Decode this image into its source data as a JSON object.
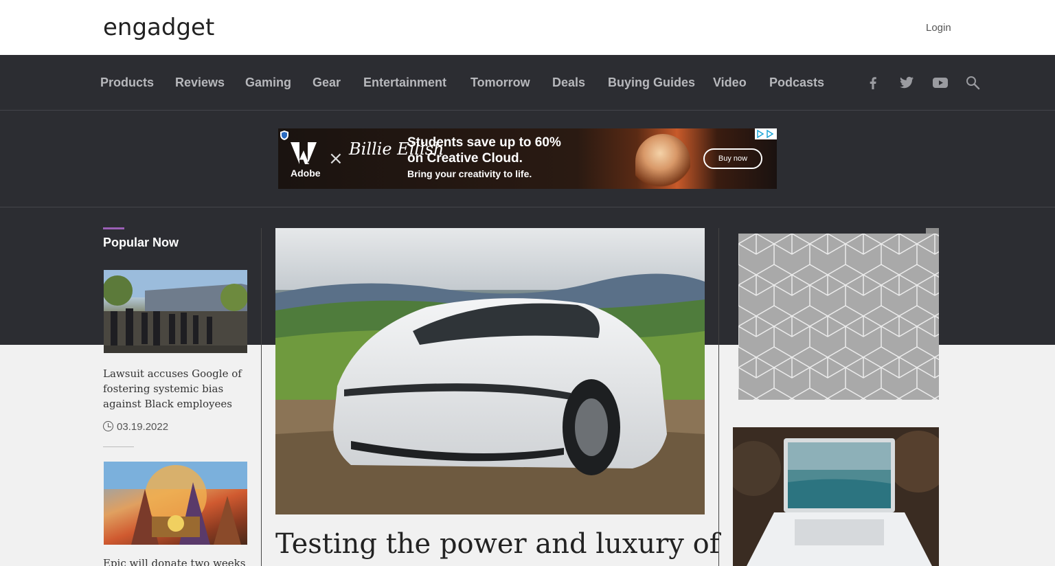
{
  "header": {
    "logo": "engadget",
    "login_label": "Login"
  },
  "nav": {
    "items": [
      "Products",
      "Reviews",
      "Gaming",
      "Gear",
      "Entertainment",
      "Tomorrow",
      "Deals",
      "Buying Guides",
      "Video",
      "Podcasts"
    ],
    "social_icons": [
      "facebook-icon",
      "twitter-icon",
      "youtube-icon",
      "search-icon"
    ]
  },
  "banner_ad": {
    "brand": "Adobe",
    "partner": "Billie Eilish",
    "headline": "Students save up to 60% on Creative Cloud.",
    "subline": "Bring your creativity to life.",
    "cta": "Buy now"
  },
  "popular": {
    "heading": "Popular Now",
    "stories": [
      {
        "title": "Lawsuit accuses Google of fostering systemic bias against Black employees",
        "date": "03.19.2022"
      },
      {
        "title": "Epic will donate two weeks of"
      }
    ]
  },
  "main": {
    "headline": "Testing the power and luxury of"
  },
  "colors": {
    "dark_band": "#2c2d32",
    "accent": "#9b5fb6",
    "nav_text": "#b7b8bc"
  }
}
